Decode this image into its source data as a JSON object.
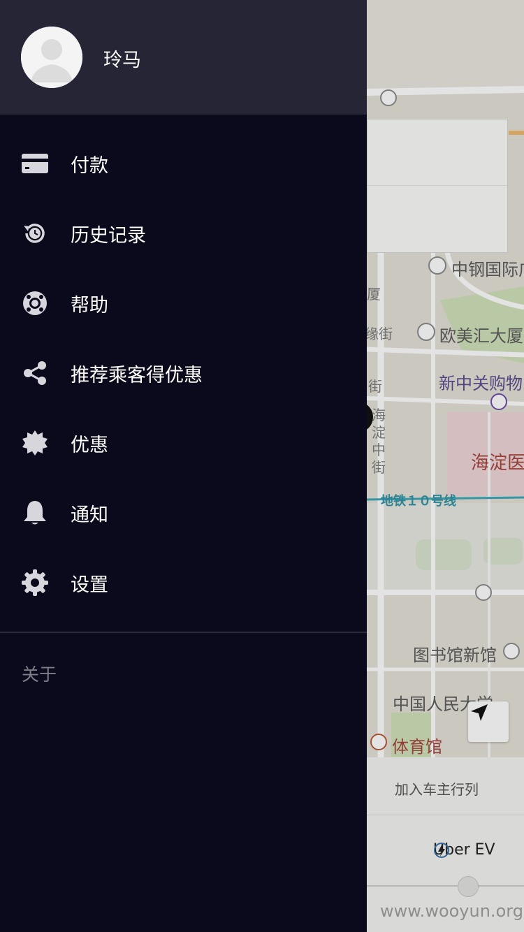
{
  "drawer": {
    "username": "玲马",
    "menu": [
      {
        "label": "付款",
        "icon": "credit-card-icon"
      },
      {
        "label": "历史记录",
        "icon": "history-icon"
      },
      {
        "label": "帮助",
        "icon": "lifebuoy-icon"
      },
      {
        "label": "推荐乘客得优惠",
        "icon": "share-icon"
      },
      {
        "label": "优惠",
        "icon": "badge-icon"
      },
      {
        "label": "通知",
        "icon": "bell-icon"
      },
      {
        "label": "设置",
        "icon": "gear-icon"
      }
    ],
    "about_label": "关于"
  },
  "map": {
    "labels": {
      "zhonggang": "中钢国际广",
      "oumeihui": "欧美汇大厦",
      "xinzhongguan": "新中关购物",
      "haidian": "海淀医",
      "subway": "地铁１０号线",
      "library": "图书馆新馆",
      "renmin": "中国人民大学",
      "gym": "体育馆",
      "street1": "街",
      "street2": "海淀中街",
      "street3": "缘街",
      "street4": "厦"
    },
    "join_label": "加入车主行列",
    "ev_label": "Uber EV"
  },
  "watermark": "www.wooyun.org",
  "colors": {
    "drawer_bg": "#0b0a1c",
    "profile_bg": "#252536",
    "icon_color": "#d6d6dc",
    "about_color": "#7e7e8a"
  }
}
